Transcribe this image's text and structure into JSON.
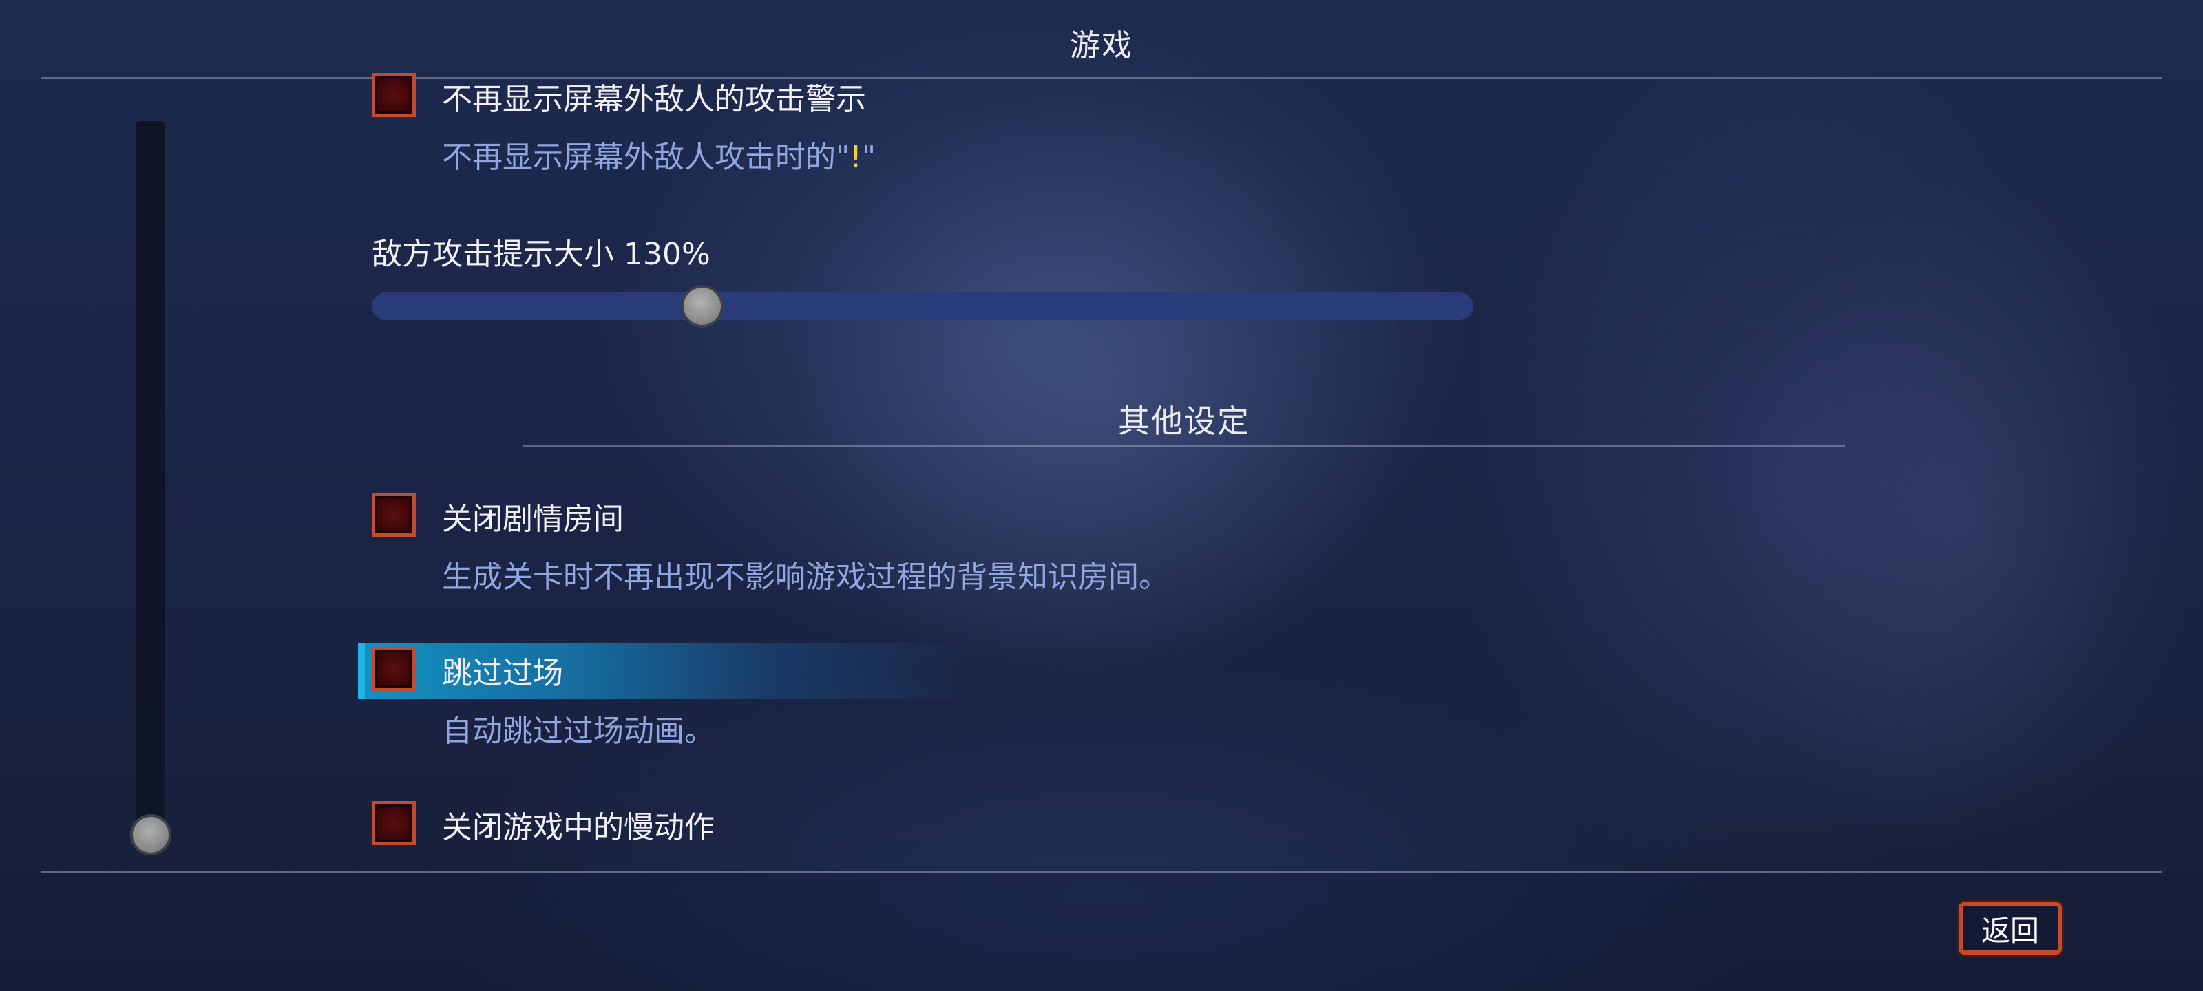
{
  "header": {
    "title": "游戏"
  },
  "options_top": {
    "offscreen_warning": {
      "label": "不再显示屏幕外敌人的攻击警示",
      "desc_prefix": "不再显示屏幕外敌人攻击时的\"",
      "desc_mark": "!",
      "desc_suffix": "\"",
      "checked": false
    }
  },
  "slider": {
    "label": "敌方攻击提示大小",
    "value_text": "130%",
    "fill_fraction": 0.3
  },
  "section": {
    "title": "其他设定"
  },
  "options": [
    {
      "label": "关闭剧情房间",
      "desc": "生成关卡时不再出现不影响游戏过程的背景知识房间。",
      "checked": false
    },
    {
      "label": "跳过过场",
      "desc": "自动跳过过场动画。",
      "checked": false,
      "focused": true
    },
    {
      "label": "关闭游戏中的慢动作",
      "checked": false
    }
  ],
  "scrollbar": {
    "position_fraction": 1.0
  },
  "footer": {
    "back_label": "返回"
  },
  "colors": {
    "checkbox_border": "#c24b2e",
    "checkbox_fill": "#3a0608",
    "description_text": "#8fa6e0",
    "exclamation": "#f2d23a",
    "highlight": "#1496c8",
    "slider_track": "#2a3b7a"
  }
}
